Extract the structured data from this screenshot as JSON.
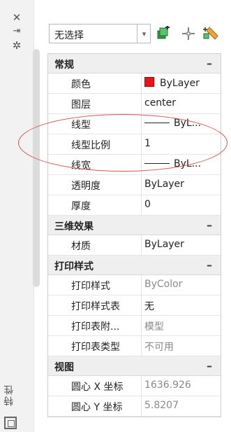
{
  "sidebar": {
    "close_icon": "close-icon",
    "pin_icon": "autohide-icon",
    "settings_icon": "settings-icon",
    "panel_title": "特性"
  },
  "selector": {
    "value": "无选择"
  },
  "toolbar": {
    "icons": [
      "toggle-pickadd-icon",
      "select-objects-icon",
      "quick-select-icon"
    ]
  },
  "sections": {
    "general": {
      "title": "常规",
      "rows": [
        {
          "label": "颜色",
          "value": "ByLayer"
        },
        {
          "label": "图层",
          "value": "center"
        },
        {
          "label": "线型",
          "value": "ByL..."
        },
        {
          "label": "线型比例",
          "value": "1"
        },
        {
          "label": "线宽",
          "value": "ByL..."
        },
        {
          "label": "透明度",
          "value": "ByLayer"
        },
        {
          "label": "厚度",
          "value": "0"
        }
      ]
    },
    "three_d": {
      "title": "三维效果",
      "rows": [
        {
          "label": "材质",
          "value": "ByLayer"
        }
      ]
    },
    "plot": {
      "title": "打印样式",
      "rows": [
        {
          "label": "打印样式",
          "value": "ByColor"
        },
        {
          "label": "打印样式表",
          "value": "无"
        },
        {
          "label": "打印表附...",
          "value": "模型"
        },
        {
          "label": "打印表类型",
          "value": "不可用"
        }
      ]
    },
    "view": {
      "title": "视图",
      "rows": [
        {
          "label": "圆心 X 坐标",
          "value": "1636.926"
        },
        {
          "label": "圆心 Y 坐标",
          "value": "5.8207"
        }
      ]
    }
  },
  "collapse_symbol": "–",
  "colors": {
    "color_swatch": "#e8131b",
    "annotation_ellipse": "#d9534f"
  }
}
